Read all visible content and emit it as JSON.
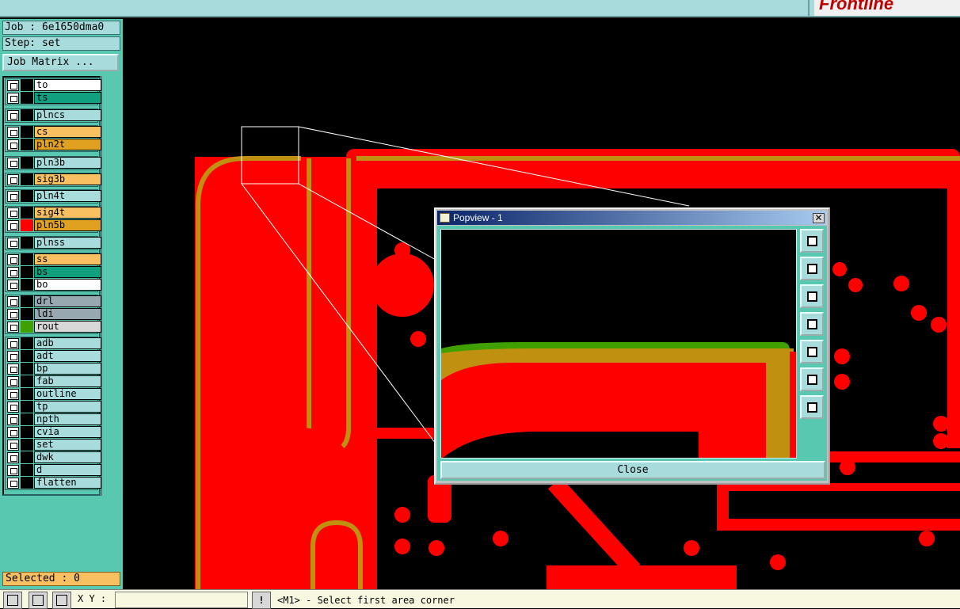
{
  "brand": {
    "name": "Frontline"
  },
  "job": {
    "label": "Job : 6e1650dma0",
    "step": "Step: set"
  },
  "job_matrix_button": "Job Matrix ...",
  "layers": [
    {
      "name": "to",
      "color": "#ffffff",
      "swatch": "#000000"
    },
    {
      "name": "ts",
      "color": "#10a080",
      "swatch": "#000000"
    },
    {
      "name": "plncs",
      "color": "#a8dcdc",
      "swatch": "#000000"
    },
    {
      "name": "cs",
      "color": "#f8c060",
      "swatch": "#000000"
    },
    {
      "name": "pln2t",
      "color": "#e0a020",
      "swatch": "#000000"
    },
    {
      "name": "pln3b",
      "color": "#a8dcdc",
      "swatch": "#000000"
    },
    {
      "name": "sig3b",
      "color": "#f8c060",
      "swatch": "#000000"
    },
    {
      "name": "pln4t",
      "color": "#a8dcdc",
      "swatch": "#000000"
    },
    {
      "name": "sig4t",
      "color": "#f8c060",
      "swatch": "#000000"
    },
    {
      "name": "pln5b",
      "color": "#e0a020",
      "swatch": "#ff0000"
    },
    {
      "name": "plnss",
      "color": "#a8dcdc",
      "swatch": "#000000"
    },
    {
      "name": "ss",
      "color": "#f8c060",
      "swatch": "#000000"
    },
    {
      "name": "bs",
      "color": "#10a080",
      "swatch": "#000000"
    },
    {
      "name": "bo",
      "color": "#ffffff",
      "swatch": "#000000"
    },
    {
      "name": "drl",
      "color": "#98a8b0",
      "swatch": "#000000"
    },
    {
      "name": "ldi",
      "color": "#98a8b0",
      "swatch": "#000000"
    },
    {
      "name": "rout",
      "color": "#d8d8d8",
      "swatch": "#40a000"
    },
    {
      "name": "adb",
      "color": "#a8dcdc",
      "swatch": "#000000"
    },
    {
      "name": "adt",
      "color": "#a8dcdc",
      "swatch": "#000000"
    },
    {
      "name": "bp",
      "color": "#a8dcdc",
      "swatch": "#000000"
    },
    {
      "name": "fab",
      "color": "#a8dcdc",
      "swatch": "#000000"
    },
    {
      "name": "outline",
      "color": "#a8dcdc",
      "swatch": "#000000"
    },
    {
      "name": "tp",
      "color": "#a8dcdc",
      "swatch": "#000000"
    },
    {
      "name": "npth",
      "color": "#a8dcdc",
      "swatch": "#000000"
    },
    {
      "name": "cvia",
      "color": "#a8dcdc",
      "swatch": "#000000"
    },
    {
      "name": "set",
      "color": "#a8dcdc",
      "swatch": "#000000"
    },
    {
      "name": "dwk",
      "color": "#a8dcdc",
      "swatch": "#000000"
    },
    {
      "name": "d",
      "color": "#a8dcdc",
      "swatch": "#000000"
    },
    {
      "name": "flatten",
      "color": "#a8dcdc",
      "swatch": "#000000"
    }
  ],
  "selected": "Selected : 0",
  "status": {
    "xy_label": "X Y :",
    "bang": "!",
    "message": "<M1> - Select first area corner"
  },
  "popview": {
    "title": "Popview - 1",
    "close_x": "✕",
    "close_label": "Close",
    "tools": [
      "zoom-fit-icon",
      "pan-up-icon",
      "pan-down-icon",
      "pan-left-icon",
      "pan-right-icon",
      "zoom-out-icon",
      "zoom-in-icon"
    ]
  },
  "colors": {
    "copper": "#ff0000",
    "trace_outline": "#c09010",
    "green_layer": "#40a000"
  }
}
